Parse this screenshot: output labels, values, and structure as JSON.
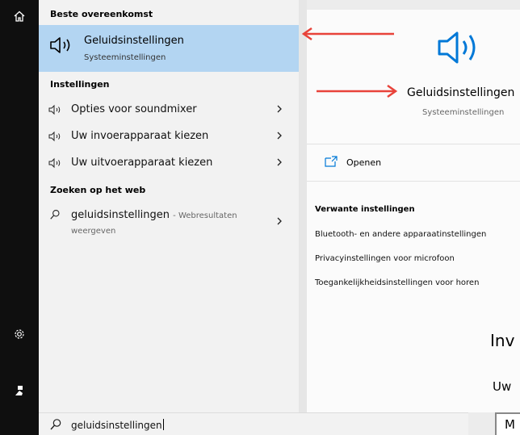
{
  "sections": {
    "best_match": "Beste overeenkomst",
    "settings": "Instellingen",
    "web": "Zoeken op het web"
  },
  "best": {
    "title": "Geluidsinstellingen",
    "subtitle": "Systeeminstellingen"
  },
  "setting_items": [
    {
      "label": "Opties voor soundmixer",
      "icon": "speaker-icon"
    },
    {
      "label": "Uw invoerapparaat kiezen",
      "icon": "speaker-icon"
    },
    {
      "label": "Uw uitvoerapparaat kiezen",
      "icon": "speaker-icon"
    }
  ],
  "web_result": {
    "query": "geluidsinstellingen",
    "suffix": "- Webresultaten weergeven"
  },
  "search": {
    "value": "geluidsinstellingen"
  },
  "preview": {
    "title": "Geluidsinstellingen",
    "subtitle": "Systeeminstellingen",
    "open_label": "Openen",
    "related_heading": "Verwante instellingen",
    "related_links": [
      "Bluetooth- en andere apparaatinstellingen",
      "Privacyinstellingen voor microfoon",
      "Toegankelijkheidsinstellingen voor horen"
    ]
  },
  "background": {
    "heading": "Inv",
    "subheading": "Uw",
    "box_text": "M"
  },
  "colors": {
    "accent": "#0078d7",
    "highlight": "#b3d5f2",
    "annotation_arrow": "#e8433a"
  }
}
